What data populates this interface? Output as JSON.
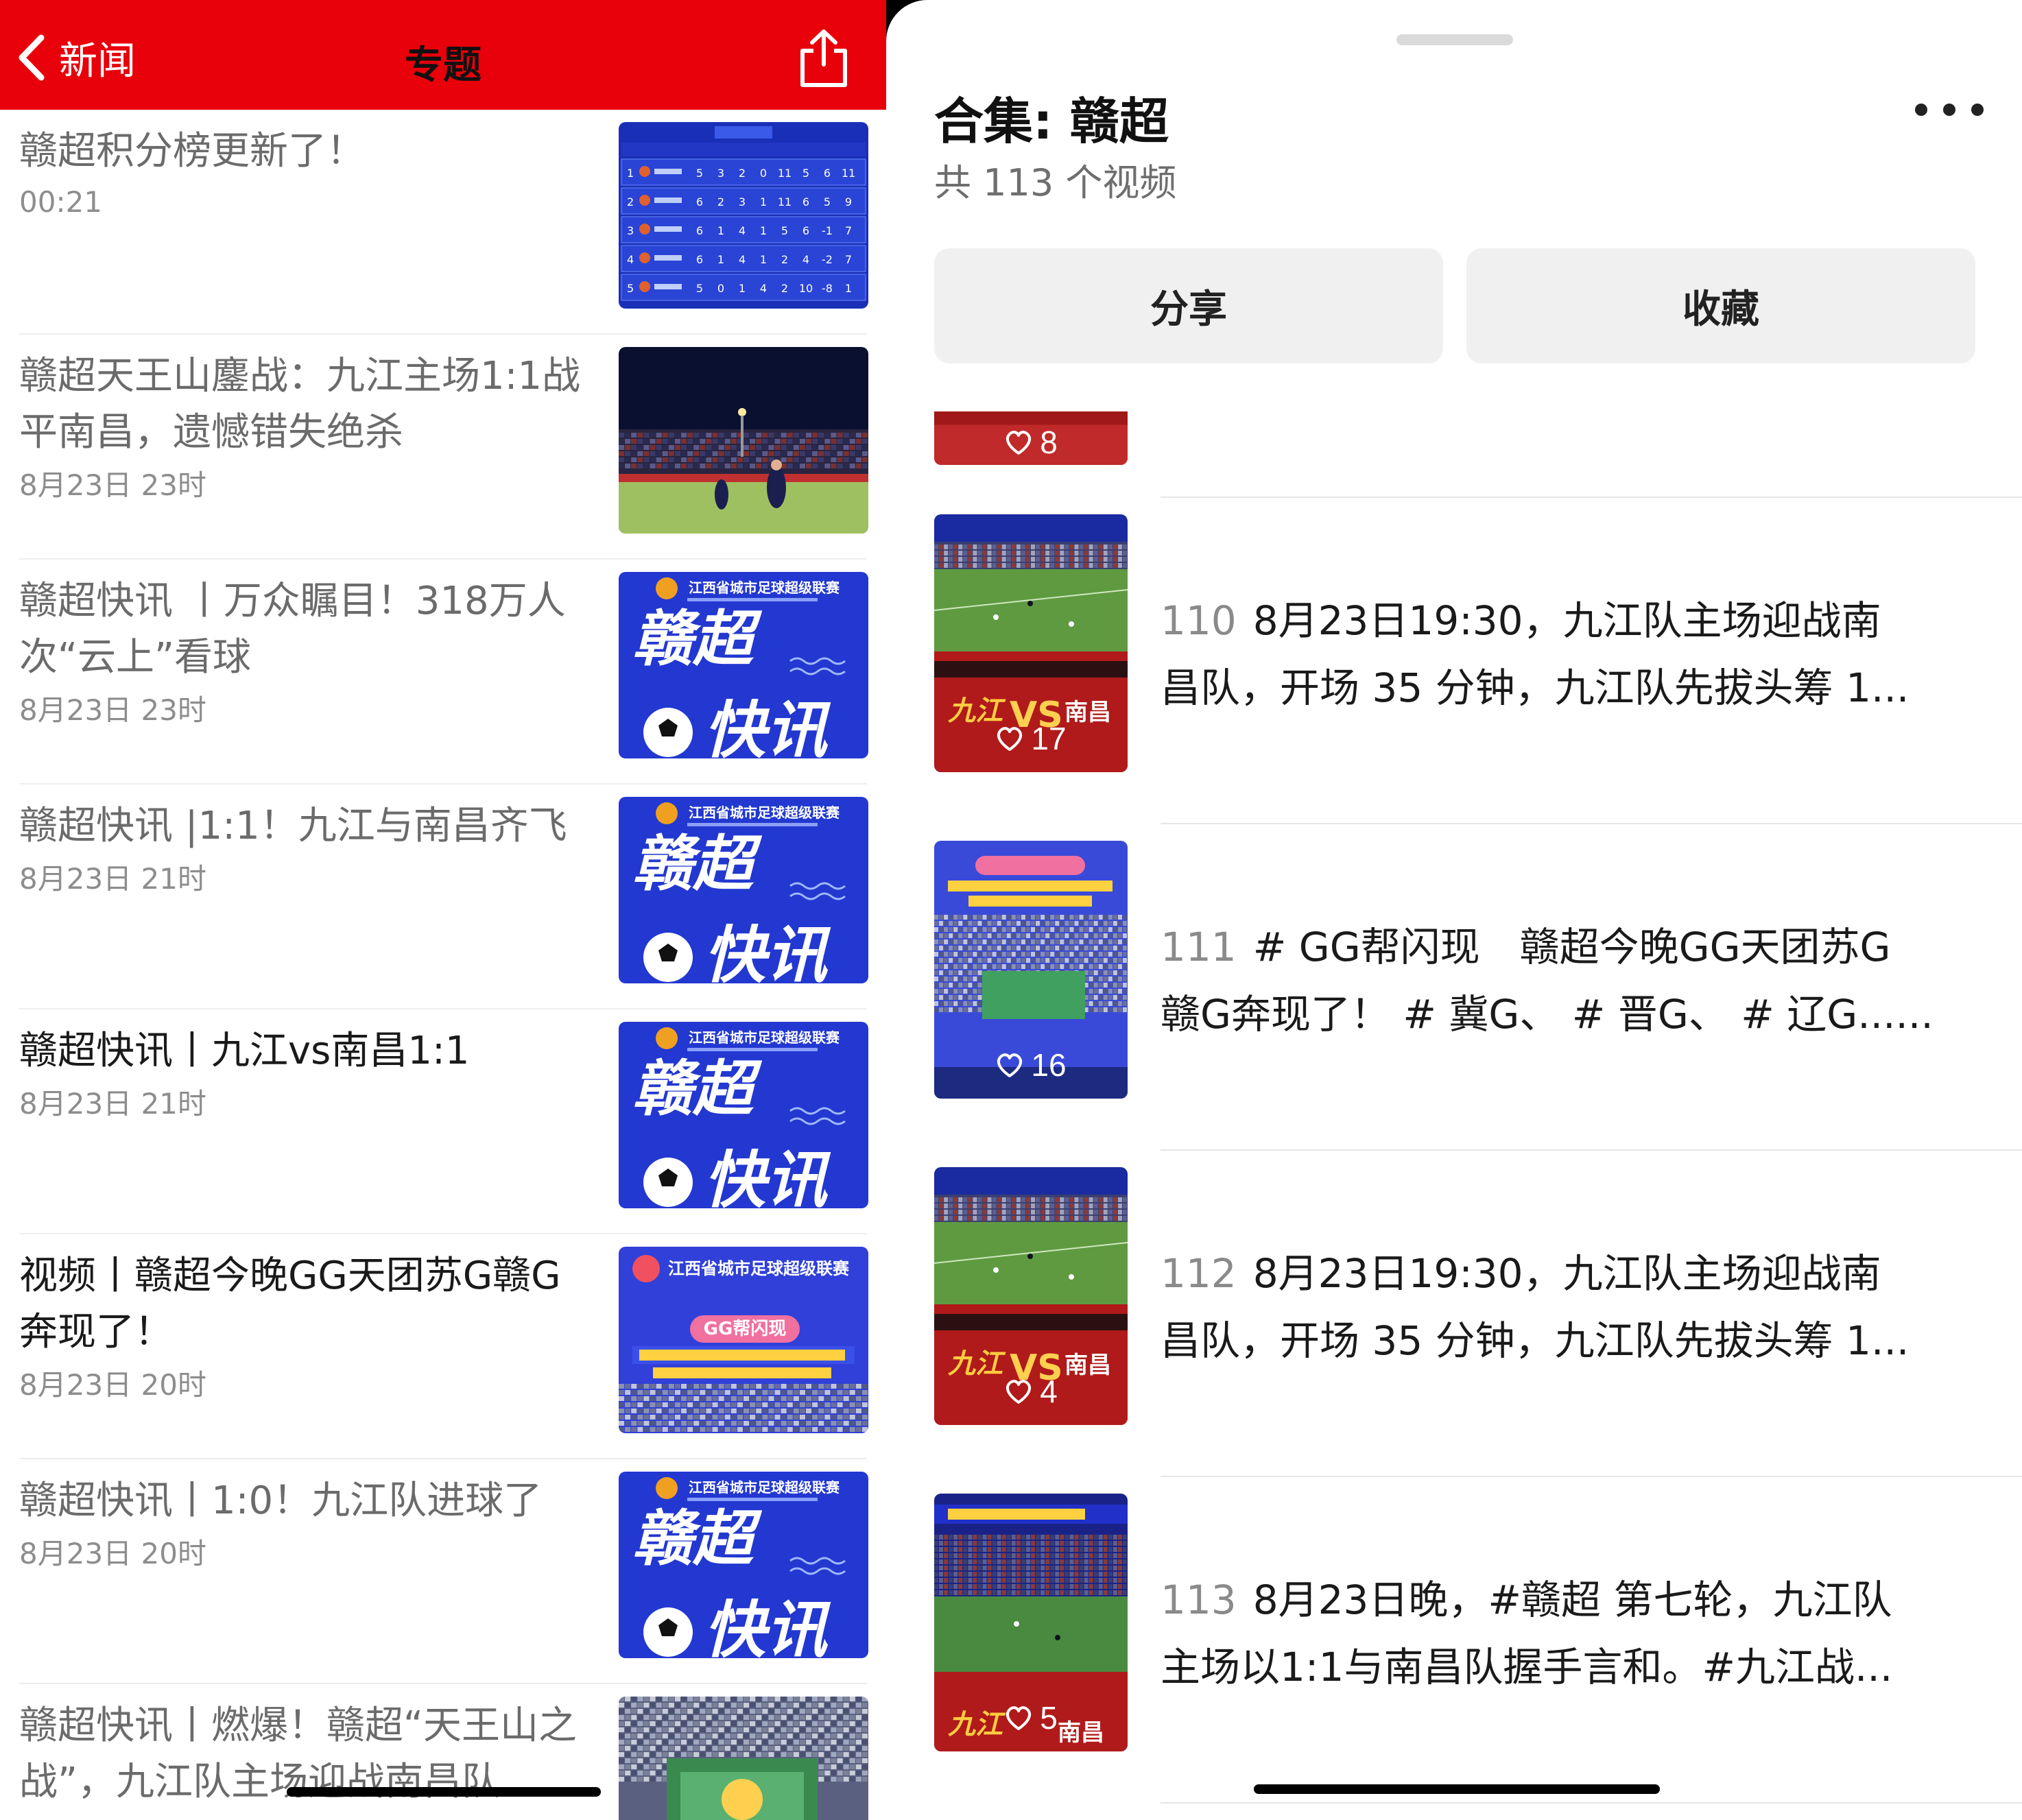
{
  "left_header": {
    "back_label": "新闻",
    "title": "专题",
    "background": "#e8000b",
    "share_icon": "share-icon"
  },
  "news": [
    {
      "title": "赣超积分榜更新了！",
      "time": "00:21",
      "thumb": "standings-table"
    },
    {
      "title": "赣超天王山鏖战：九江主场1:1战平南昌，遗憾错失绝杀",
      "time": "8月23日 23时",
      "thumb": "night-football"
    },
    {
      "title": "赣超快讯 丨万众瞩目！318万人次“云上”看球",
      "time": "8月23日 23时",
      "thumb": "ganchao-news",
      "banner": "江西省城市足球超级联赛",
      "big1": "赣超",
      "big2": "快讯"
    },
    {
      "title": "赣超快讯 |1:1！九江与南昌齐飞",
      "time": "8月23日 21时",
      "thumb": "ganchao-news",
      "banner": "江西省城市足球超级联赛",
      "big1": "赣超",
      "big2": "快讯"
    },
    {
      "title": "赣超快讯丨九江vs南昌1:1",
      "time": "8月23日 21时",
      "thumb": "ganchao-news",
      "banner": "江西省城市足球超级联赛",
      "big1": "赣超",
      "big2": "快讯"
    },
    {
      "title": "视频丨赣超今晚GG天团苏G赣G奔现了！",
      "time": "8月23日 20时",
      "thumb": "gg-flash",
      "banner": "江西省城市足球超级联赛",
      "ribbon": "GG帮闪现"
    },
    {
      "title": "赣超快讯丨1:0！九江队进球了",
      "time": "8月23日 20时",
      "thumb": "ganchao-news",
      "banner": "江西省城市足球超级联赛",
      "big1": "赣超",
      "big2": "快讯"
    },
    {
      "title": "赣超快讯丨燃爆！赣超“天王山之战”，九江队主场迎战南昌队",
      "time": "",
      "thumb": "stadium-crowd"
    }
  ],
  "collection": {
    "title": "合集: 赣超",
    "subtitle": "共 113 个视频",
    "share_label": "分享",
    "collect_label": "收藏"
  },
  "videos": [
    {
      "num": "",
      "line1": "",
      "line2": "",
      "likes": "8",
      "thumb": "partial-red"
    },
    {
      "num": "110",
      "line1": "8月23日19:30，九江队主场迎战南",
      "line2": "昌队，开场 35 分钟，九江队先拔头筹 1...",
      "likes": "17",
      "thumb": "match-vs"
    },
    {
      "num": "111",
      "line1": "# GG帮闪现　赣超今晚GG天团苏G",
      "line2": "赣G奔现了！ # 冀G、 # 晋G、 # 辽G......",
      "likes": "16",
      "thumb": "gg-stands"
    },
    {
      "num": "112",
      "line1": "8月23日19:30，九江队主场迎战南",
      "line2": "昌队，开场 35 分钟，九江队先拔头筹 1...",
      "likes": "4",
      "thumb": "match-vs"
    },
    {
      "num": "113",
      "line1": "8月23日晚，#赣超 第七轮，九江队",
      "line2": "主场以1:1与南昌队握手言和。#九江战...",
      "likes": "5",
      "thumb": "night-pitch"
    }
  ],
  "colors": {
    "accent_red": "#e8000b",
    "thumb_blue": "#1f35c9",
    "muted_text": "#6b6b6b"
  }
}
